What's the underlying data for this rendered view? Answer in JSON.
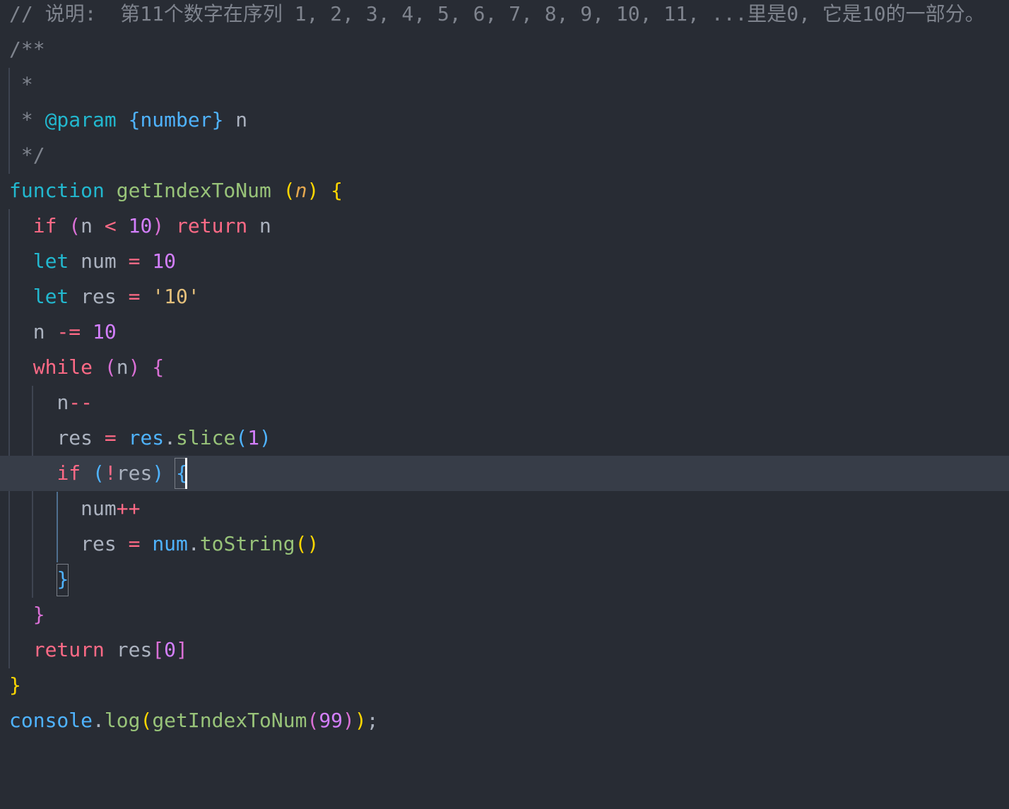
{
  "editor": {
    "theme_colors": {
      "background": "#282c34",
      "current_line": "#373d48",
      "comment": "#7f848e",
      "keyword": "#ff6a86",
      "declaration": "#22b8cf",
      "function": "#98c379",
      "parameter": "#e5a84f",
      "number": "#d47fff",
      "string": "#e5c07b",
      "object": "#4fb3ff",
      "text": "#abb2bf",
      "bracket_level1": "#ffd700",
      "bracket_level2": "#da70d6",
      "bracket_level3": "#4fb3ff"
    },
    "cursor_line": 13,
    "lines": {
      "l1": {
        "comment": "// 说明:  第11个数字在序列 1, 2, 3, 4, 5, 6, 7, 8, 9, 10, 11, ...里是0, 它是10的一部分。"
      },
      "l2": {
        "comment": "/**"
      },
      "l3": {
        "star": " *"
      },
      "l4": {
        "star": " * ",
        "tag": "@param",
        "space": " ",
        "type": "{number}",
        "name": " n"
      },
      "l5": {
        "close": " */"
      },
      "l6": {
        "kw": "function",
        "sp": " ",
        "fn": "getIndexToNum",
        "sp2": " ",
        "po": "(",
        "param": "n",
        "pc": ")",
        "sp3": " ",
        "bo": "{"
      },
      "l7": {
        "indent": "  ",
        "kw": "if",
        "sp": " ",
        "po": "(",
        "id": "n",
        "op": " < ",
        "num": "10",
        "pc": ")",
        "sp2": " ",
        "ret": "return",
        "id2": " n"
      },
      "l8": {
        "indent": "  ",
        "kw": "let",
        "id": " num ",
        "op": "=",
        "sp": " ",
        "num": "10"
      },
      "l9": {
        "indent": "  ",
        "kw": "let",
        "id": " res ",
        "op": "=",
        "sp": " ",
        "str": "'10'"
      },
      "l10": {
        "indent": "  ",
        "id": "n ",
        "op": "-=",
        "sp": " ",
        "num": "10"
      },
      "l11": {
        "indent": "  ",
        "kw": "while",
        "sp": " ",
        "po": "(",
        "id": "n",
        "pc": ")",
        "sp2": " ",
        "bo": "{"
      },
      "l12": {
        "indent": "    ",
        "id": "n",
        "op": "--"
      },
      "l13": {
        "indent": "    ",
        "id": "res ",
        "op": "=",
        "sp": " ",
        "obj": "res",
        "dot": ".",
        "meth": "slice",
        "po": "(",
        "num": "1",
        "pc": ")"
      },
      "l14": {
        "indent": "    ",
        "kw": "if",
        "sp": " ",
        "po": "(",
        "op": "!",
        "id": "res",
        "pc": ")",
        "sp2": " ",
        "bo": "{"
      },
      "l15": {
        "indent": "      ",
        "id": "num",
        "op": "++"
      },
      "l16": {
        "indent": "      ",
        "id": "res ",
        "op": "=",
        "sp": " ",
        "obj": "num",
        "dot": ".",
        "meth": "toString",
        "po": "(",
        "pc": ")"
      },
      "l17": {
        "indent": "    ",
        "bc": "}"
      },
      "l18": {
        "indent": "  ",
        "bc": "}"
      },
      "l19": {
        "indent": "  ",
        "ret": "return",
        "id": " res",
        "po": "[",
        "num": "0",
        "pc": "]"
      },
      "l20": {
        "bc": "}"
      },
      "l21": {
        "obj": "console",
        "dot": ".",
        "meth": "log",
        "po": "(",
        "fn": "getIndexToNum",
        "po2": "(",
        "num": "99",
        "pc2": ")",
        "pc": ")",
        "semi": ";"
      }
    }
  }
}
